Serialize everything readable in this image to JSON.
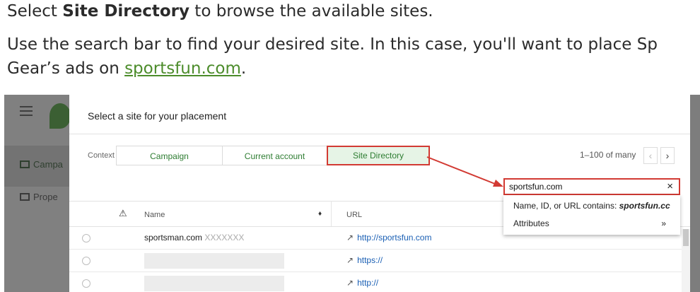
{
  "doc": {
    "line1_pre": "Select ",
    "line1_bold": "Site Directory",
    "line1_post": " to browse the available sites.",
    "line2": "Use the search bar to find your desired site. In this case, you'll want to place Sp",
    "line3_pre": "Gear’s ads on ",
    "line3_link": "sportsfun.com",
    "line3_post": "."
  },
  "app": {
    "nav": [
      {
        "label": "Campa"
      },
      {
        "label": "Prope"
      }
    ]
  },
  "dialog": {
    "title": "Select a site for your placement",
    "context_label": "Context",
    "tabs": [
      {
        "label": "Campaign"
      },
      {
        "label": "Current account"
      },
      {
        "label": "Site Directory"
      }
    ],
    "pager": "1–100 of many",
    "columns": {
      "warning_icon": "⚠",
      "name": "Name",
      "sort_icon": "♦",
      "url": "URL"
    },
    "rows": [
      {
        "name": "sportsman.com",
        "name_suffix": "XXXXXXX",
        "url": "http://sportsfun.com"
      },
      {
        "name": "",
        "name_suffix": "",
        "url": "https://"
      },
      {
        "name": "",
        "name_suffix": "",
        "url": "http://"
      }
    ],
    "search": {
      "value": "sportsfun.com",
      "suggestion_prefix": "Name, ID, or URL contains: ",
      "suggestion_term": "sportsfun.cc",
      "attributes_label": "Attributes",
      "attributes_arrow": "»"
    }
  },
  "colors": {
    "highlight": "#d23a33",
    "tab_text": "#2e7d32",
    "link": "#1a5fb4",
    "doc_link": "#4c8c2b"
  }
}
